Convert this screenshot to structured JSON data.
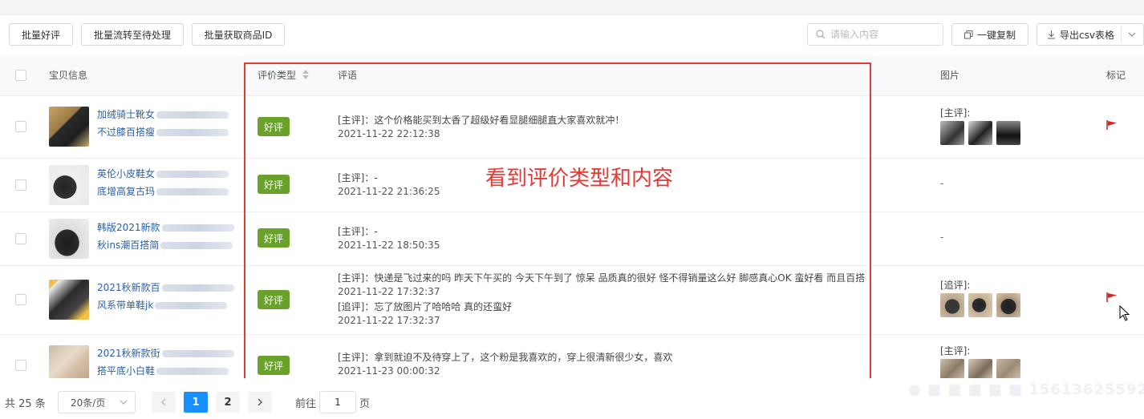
{
  "toolbar": {
    "batch_good_review": "批量好评",
    "batch_transfer_pending": "批量流转至待处理",
    "batch_get_product_id": "批量获取商品ID",
    "search_placeholder": "请输入内容",
    "copy_all": "一键复制",
    "export_csv": "导出csv表格"
  },
  "table": {
    "headers": {
      "product": "宝贝信息",
      "rating_type": "评价类型",
      "review": "评语",
      "images": "图片",
      "mark": "标记"
    },
    "rows": [
      {
        "title_line1": "加绒骑士靴女",
        "title_line2": "不过膝百搭瘦",
        "rating": "好评",
        "reviews": [
          {
            "text": "[主评]：这个价格能买到太香了超级好看显腿细腿直大家喜欢就冲！",
            "time": "2021-11-22 22:12:38"
          }
        ],
        "image_label": "[主评]:",
        "has_images": true,
        "flagged": true
      },
      {
        "title_line1": "英伦小皮鞋女",
        "title_line2": "底增高复古玛",
        "rating": "好评",
        "reviews": [
          {
            "text": "[主评]：-",
            "time": "2021-11-22 21:36:25"
          }
        ],
        "image_label": "-",
        "has_images": false,
        "flagged": false
      },
      {
        "title_line1": "韩版2021新款",
        "title_line2": "秋ins潮百搭简",
        "rating": "好评",
        "reviews": [
          {
            "text": "[主评]：-",
            "time": "2021-11-22 18:50:35"
          }
        ],
        "image_label": "-",
        "has_images": false,
        "flagged": false
      },
      {
        "title_line1": "2021秋新款百",
        "title_line2": "风系带单鞋jk",
        "rating": "好评",
        "reviews": [
          {
            "text": "[主评]：快递是飞过来的吗 昨天下午买的 今天下午到了 惊呆 品质真的很好 怪不得销量这么好 脚感真心OK 蛮好看 而且百搭",
            "time": "2021-11-22 17:32:37"
          },
          {
            "text": "[追评]：忘了放图片了哈哈哈 真的还蛮好",
            "time": "2021-11-22 17:32:37"
          }
        ],
        "image_label": "[追评]:",
        "has_images": true,
        "flagged": true
      },
      {
        "title_line1": "2021秋新款街",
        "title_line2": "搭平底小白鞋",
        "rating": "好评",
        "reviews": [
          {
            "text": "[主评]：拿到就迫不及待穿上了，这个粉是我喜欢的，穿上很清新很少女，喜欢",
            "time": "2021-11-23 00:00:32"
          }
        ],
        "image_label": "[主评]:",
        "has_images": true,
        "flagged": false
      }
    ]
  },
  "annotation": "看到评价类型和内容",
  "pagination": {
    "total": "共 25 条",
    "page_size": "20条/页",
    "pages": [
      "1",
      "2"
    ],
    "current_page": "1",
    "goto_label": "前往",
    "goto_value": "1",
    "page_unit": "页"
  },
  "colors": {
    "badge_green": "#6aa12b",
    "link_blue": "#2a5fa8",
    "annotation_red": "#e53935",
    "active_page": "#1890ff",
    "flag_red": "#e02020"
  }
}
